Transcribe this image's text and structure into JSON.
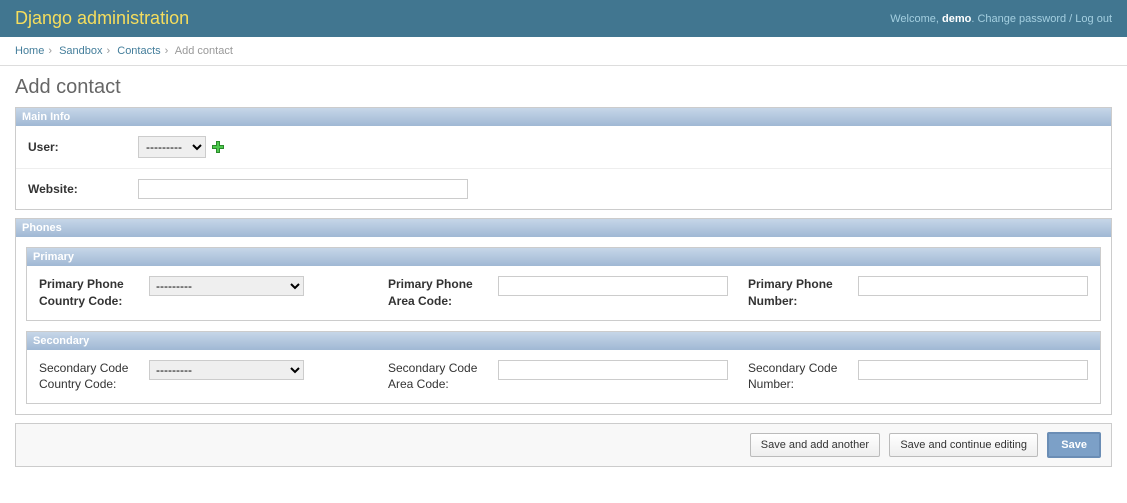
{
  "header": {
    "title": "Django administration",
    "welcome": "Welcome, ",
    "username": "demo",
    "change_password": "Change password",
    "logout": "Log out"
  },
  "breadcrumbs": {
    "home": "Home",
    "sandbox": "Sandbox",
    "contacts": "Contacts",
    "current": "Add contact"
  },
  "page": {
    "title": "Add contact"
  },
  "modules": {
    "main_info": {
      "title": "Main Info",
      "user_label": "User:",
      "user_selected": "---------",
      "website_label": "Website:",
      "website_value": ""
    },
    "phones": {
      "title": "Phones",
      "primary": {
        "title": "Primary",
        "country_code_label": "Primary Phone Country Code:",
        "country_code_selected": "---------",
        "area_code_label": "Primary Phone Area Code:",
        "area_code_value": "",
        "number_label": "Primary Phone Number:",
        "number_value": ""
      },
      "secondary": {
        "title": "Secondary",
        "country_code_label": "Secondary Code Country Code:",
        "country_code_selected": "---------",
        "area_code_label": "Secondary Code Area Code:",
        "area_code_value": "",
        "number_label": "Secondary Code Number:",
        "number_value": ""
      }
    }
  },
  "buttons": {
    "save_add_another": "Save and add another",
    "save_continue": "Save and continue editing",
    "save": "Save"
  }
}
